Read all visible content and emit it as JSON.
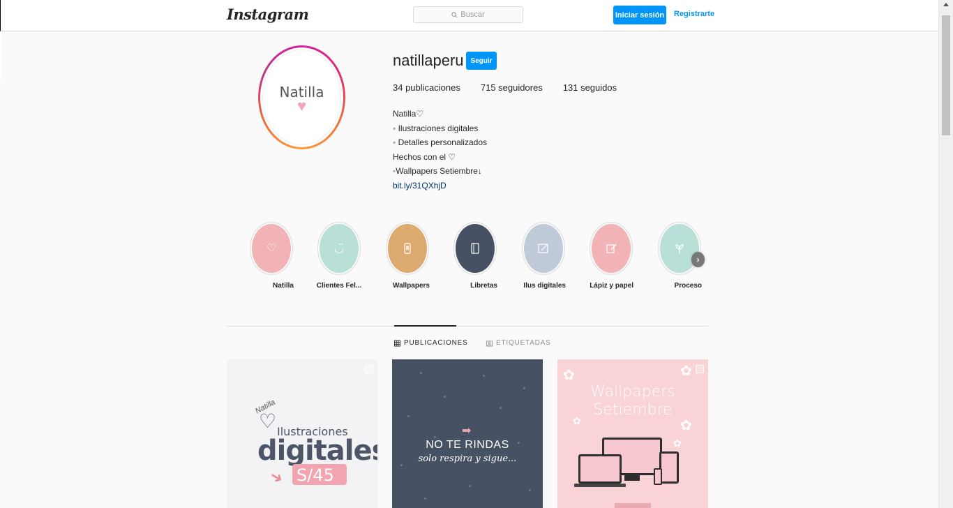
{
  "nav": {
    "logo": "Instagram",
    "search_placeholder": "Buscar",
    "login_label": "Iniciar sesión",
    "register_label": "Registrarte"
  },
  "profile": {
    "username": "natillaperu",
    "follow_label": "Seguir",
    "avatar_text": "Natilla",
    "stats": {
      "posts": "34 publicaciones",
      "followers": "715 seguidores",
      "following": "131 seguidos"
    },
    "bio": {
      "name": "Natilla♡",
      "lines": [
        "◦ Ilustraciones digitales",
        "◦ Detalles personalizados",
        "Hechos con el ♡",
        "◦Wallpapers Setiembre↓"
      ],
      "link": "bit.ly/31QXhjD"
    }
  },
  "highlights": [
    {
      "label": "Natilla",
      "color": "#f2b3b7",
      "icon": "heart-icon"
    },
    {
      "label": "Clientes Fel...",
      "color": "#b9e0d8",
      "icon": "smile-icon"
    },
    {
      "label": "Wallpapers",
      "color": "#dcaa6e",
      "icon": "phone-icon"
    },
    {
      "label": "Libretas",
      "color": "#465264",
      "icon": "notebook-icon"
    },
    {
      "label": "Ilus digitales",
      "color": "#c0cad8",
      "icon": "tablet-icon"
    },
    {
      "label": "Lápiz y papel",
      "color": "#f2b3b7",
      "icon": "pencil-icon"
    },
    {
      "label": "Proceso",
      "color": "#b9e0d8",
      "icon": "plant-icon"
    }
  ],
  "tabs": {
    "posts": "PUBLICACIONES",
    "tagged": "ETIQUETADAS"
  },
  "posts": {
    "p1": {
      "tag": "Natilla",
      "line1": "Ilustraciones",
      "line2": "digitales",
      "price": "S/45"
    },
    "p2": {
      "title": "NO TE RINDAS",
      "subtitle": "solo respira y sigue..."
    },
    "p3": {
      "title_line1": "Wallpapers",
      "title_line2": "Setiembre"
    }
  },
  "colors": {
    "accent": "#0095f6",
    "link": "#00376b"
  }
}
